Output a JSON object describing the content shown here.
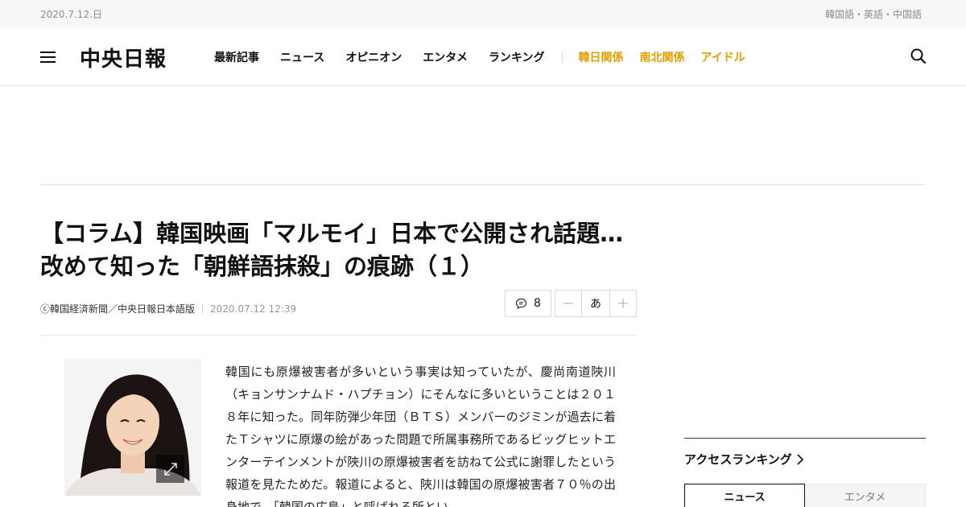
{
  "topbar": {
    "date": "2020.7.12.日",
    "languages": "韓国語・英語・中国語"
  },
  "header": {
    "logo": "中央日報",
    "nav": [
      "最新記事",
      "ニュース",
      "オピニオン",
      "エンタメ",
      "ランキング"
    ],
    "nav_accent": [
      "韓日関係",
      "南北関係",
      "アイドル"
    ],
    "accent_color": "#e0a100"
  },
  "article": {
    "title": "【コラム】韓国映画「マルモイ」日本で公開され話題…改めて知った「朝鮮語抹殺」の痕跡（１）",
    "source": "ⓒ韓国経済新聞／中央日報日本語版",
    "datetime": "2020.07.12 12:39",
    "comment_count": "8",
    "font_size_label": "あ",
    "body": "韓国にも原爆被害者が多いという事実は知っていたが、慶尚南道陜川（キョンサンナムド・ハプチョン）にそんなに多いということは２０１８年に知った。同年防弾少年団（ＢＴＳ）メンバーのジミンが過去に着たＴシャツに原爆の絵があった問題で所属事務所であるビッグヒットエンターテインメントが陜川の原爆被害者を訪ねて公式に謝罪したという報道を見たためだ。報道によると、陜川は韓国の原爆被害者７０％の出身地で、「韓国の広島」と呼ばれる所とい"
  },
  "sidebar": {
    "ranking_title": "アクセスランキング",
    "tabs": [
      "ニュース",
      "エンタメ"
    ]
  }
}
